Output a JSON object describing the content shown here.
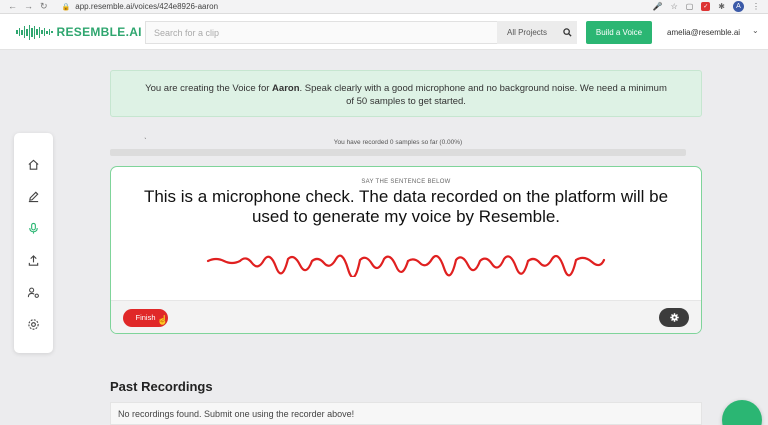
{
  "browser": {
    "url": "app.resemble.ai/voices/424e8926-aaron",
    "avatar_letter": "A"
  },
  "header": {
    "brand": "RESEMBLE.AI",
    "search_placeholder": "Search for a clip",
    "projects_label": "All Projects",
    "build_label": "Build a Voice",
    "user_email": "amelia@resemble.ai"
  },
  "sidebar": {
    "items": [
      {
        "icon": "home-icon"
      },
      {
        "icon": "pencil-icon"
      },
      {
        "icon": "microphone-icon",
        "active": true
      },
      {
        "icon": "upload-icon"
      },
      {
        "icon": "user-settings-icon"
      },
      {
        "icon": "gear-icon"
      }
    ]
  },
  "notice": {
    "prefix": "You are creating the Voice for ",
    "voice_name": "Aaron",
    "suffix": ". Speak clearly with a good microphone and no background noise. We need a minimum of 50 samples to get started."
  },
  "progress": {
    "label": "You have recorded 0 samples so far (0.00%)",
    "value": 0
  },
  "recorder": {
    "instruction": "SAY THE SENTENCE BELOW",
    "sentence": "This is a microphone check. The data recorded on the platform will be used to generate my voice by Resemble.",
    "finish_label": "Finish"
  },
  "past": {
    "title": "Past Recordings",
    "empty_message": "No recordings found. Submit one using the recorder above!"
  },
  "colors": {
    "accent": "#2bb673",
    "notice_bg": "#def2e5",
    "finish": "#e02828",
    "waveform": "#e02020"
  }
}
